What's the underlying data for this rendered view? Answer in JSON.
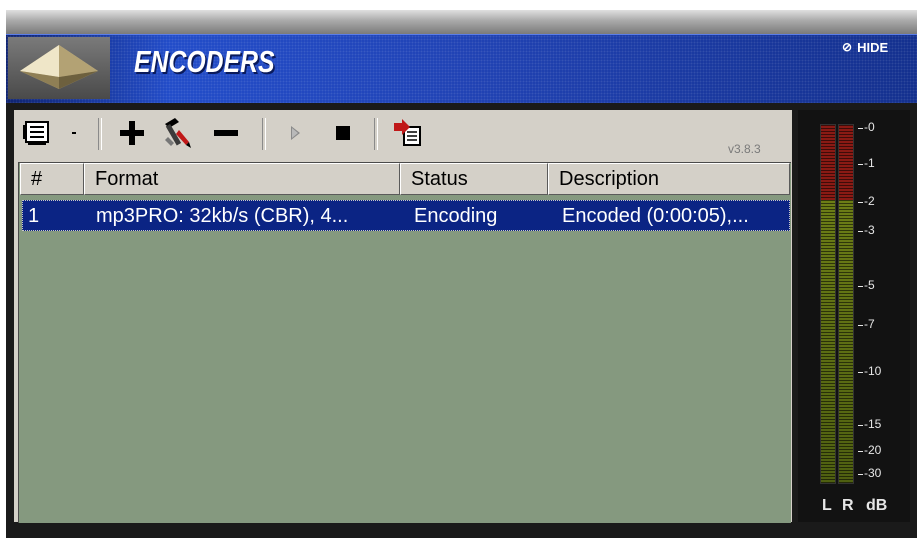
{
  "header": {
    "title": "ENCODERS",
    "hide_label": "HIDE",
    "hide_icon": "close-icon"
  },
  "toolbar": {
    "version": "v3.8.3",
    "buttons": [
      {
        "name": "encoder-menu",
        "icon": "encoder-list-icon"
      },
      {
        "name": "add",
        "icon": "plus-icon"
      },
      {
        "name": "configure",
        "icon": "tools-icon"
      },
      {
        "name": "remove",
        "icon": "minus-icon"
      },
      {
        "name": "play",
        "icon": "play-icon"
      },
      {
        "name": "stop",
        "icon": "stop-icon"
      },
      {
        "name": "export",
        "icon": "export-icon"
      }
    ]
  },
  "table": {
    "columns": [
      "#",
      "Format",
      "Status",
      "Description"
    ],
    "rows": [
      {
        "num": "1",
        "format": "mp3PRO: 32kb/s (CBR), 4...",
        "status": "Encoding",
        "description": "Encoded (0:00:05),..."
      }
    ]
  },
  "meter": {
    "scale": [
      "-0",
      "-1",
      "-2",
      "-3",
      "-5",
      "-7",
      "-10",
      "-15",
      "-20",
      "-30"
    ],
    "labels": {
      "left": "L",
      "right": "R",
      "unit": "dB"
    },
    "colors": {
      "red": "#8a1a14",
      "green": "#6c7d16"
    }
  },
  "colors": {
    "header_blue": "#1e49c8",
    "list_bg": "#85997f",
    "selection": "#0b2484",
    "panel": "#d4d0c8"
  }
}
